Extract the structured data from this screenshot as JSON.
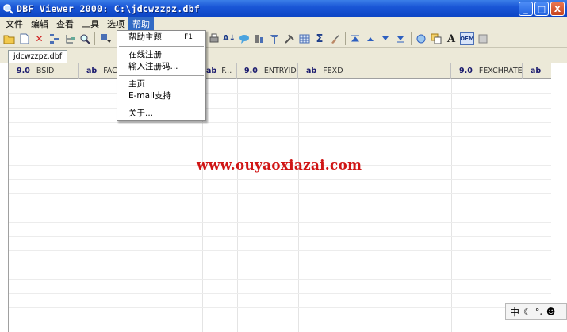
{
  "window": {
    "title": "DBF Viewer 2000: C:\\jdcwzzpz.dbf",
    "buttons": {
      "minimize": "_",
      "maximize": "□",
      "close": "X"
    }
  },
  "menubar": [
    {
      "label": "文件"
    },
    {
      "label": "编辑"
    },
    {
      "label": "查看"
    },
    {
      "label": "工具"
    },
    {
      "label": "选项"
    },
    {
      "label": "帮助"
    }
  ],
  "help_menu": {
    "items": [
      {
        "label": "帮助主题",
        "shortcut": "F1"
      },
      {
        "label": "在线注册"
      },
      {
        "label": "输入注册码..."
      },
      {
        "label": "主页"
      },
      {
        "label": "E-mail支持"
      },
      {
        "label": "关于..."
      }
    ]
  },
  "toolbar_icons": [
    "open-folder-icon",
    "new-file-icon",
    "delete-icon",
    "structure-icon",
    "tree-icon",
    "find-icon",
    "filter-down-icon",
    "print-icon",
    "sort-icon",
    "comment-icon",
    "rename-icon",
    "edit-field-icon",
    "tools-icon",
    "grid-icon",
    "sigma-icon",
    "brush-icon",
    "first-icon",
    "prev-icon",
    "next-icon",
    "last-icon",
    "search-replace-icon",
    "copy-icon",
    "font-icon",
    "oem-icon",
    "export-icon"
  ],
  "tab": {
    "label": "jdcwzzpz.dbf"
  },
  "grid": {
    "columns": [
      {
        "type": "9.0",
        "name": "BSID"
      },
      {
        "type": "ab",
        "name": "FAC"
      },
      {
        "type": "ab",
        "name": "F..."
      },
      {
        "type": "9.0",
        "name": "ENTRYID"
      },
      {
        "type": "ab",
        "name": "FEXD"
      },
      {
        "type": "9.0",
        "name": "FEXCHRATE"
      },
      {
        "type": "ab",
        "name": ""
      }
    ]
  },
  "watermark": "www.ouyaoxiazai.com",
  "ime": {
    "label": "中"
  }
}
